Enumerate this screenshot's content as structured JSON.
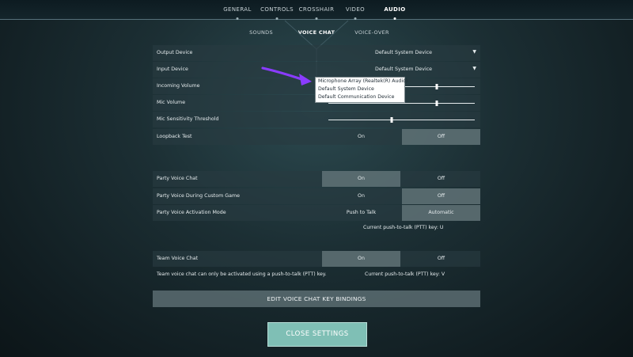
{
  "tabs": [
    {
      "label": "GENERAL",
      "active": false
    },
    {
      "label": "CONTROLS",
      "active": false
    },
    {
      "label": "CROSSHAIR",
      "active": false
    },
    {
      "label": "VIDEO",
      "active": false
    },
    {
      "label": "AUDIO",
      "active": true
    }
  ],
  "subtabs": [
    {
      "label": "SOUNDS",
      "active": false
    },
    {
      "label": "VOICE CHAT",
      "active": true
    },
    {
      "label": "VOICE-OVER",
      "active": false
    }
  ],
  "settings": {
    "output_device": {
      "label": "Output Device",
      "value": "Default System Device"
    },
    "input_device": {
      "label": "Input Device",
      "value": "Default System Device"
    },
    "incoming_volume": {
      "label": "Incoming Volume",
      "level": 0.74
    },
    "mic_volume": {
      "label": "Mic Volume",
      "level": 0.74
    },
    "mic_sensitivity": {
      "label": "Mic Sensitivity Threshold",
      "level": 0.43
    },
    "loopback": {
      "label": "Loopback Test",
      "on": "On",
      "off": "Off",
      "selected": "off"
    },
    "party_voice_chat": {
      "label": "Party Voice Chat",
      "on": "On",
      "off": "Off",
      "selected": "on"
    },
    "party_custom_game": {
      "label": "Party Voice During Custom Game",
      "on": "On",
      "off": "Off",
      "selected": "off"
    },
    "party_activation": {
      "label": "Party Voice Activation Mode",
      "ptt": "Push to Talk",
      "auto": "Automatic",
      "selected": "auto"
    },
    "party_ptt_key": "Current push-to-talk (PTT) key: U",
    "team_voice_chat": {
      "label": "Team Voice Chat",
      "on": "On",
      "off": "Off",
      "selected": "on"
    },
    "team_note": "Team voice chat can only be activated using a push-to-talk (PTT) key.",
    "team_ptt_key": "Current push-to-talk (PTT) key: V"
  },
  "dropdown_options": [
    "Microphone Array (Realtek(R) Audio)",
    "Default System Device",
    "Default Communication Device"
  ],
  "buttons": {
    "edit_bindings": "EDIT VOICE CHAT KEY BINDINGS",
    "close_settings": "CLOSE SETTINGS"
  },
  "colors": {
    "accent_button": "#7fbfb5",
    "arrow": "#8a3cff"
  }
}
